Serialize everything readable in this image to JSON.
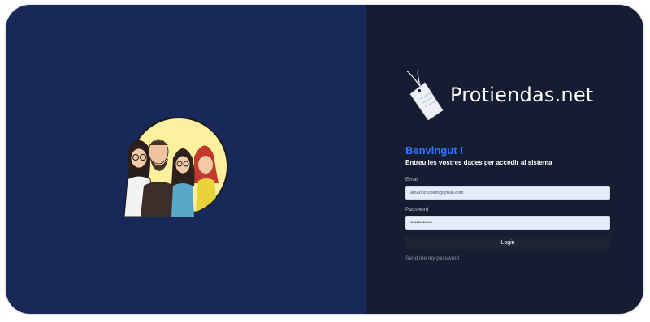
{
  "brand": {
    "name": "Protiendas.net",
    "logo_icon": "price-tag-icon"
  },
  "illustration": {
    "icon": "team-avatar-illustration"
  },
  "login": {
    "welcome": "Benvingut !",
    "subtitle": "Entreu les vostres dades per accedir al sistema",
    "email_label": "Email",
    "email_value": "amadricurdelb@gmail.com",
    "password_label": "Password",
    "password_value": "••••••••••••••",
    "login_button": "Login",
    "forgot_link": "Send me my password"
  },
  "colors": {
    "left_panel_bg": "#182858",
    "right_panel_bg": "#161c31",
    "accent": "#2f74ff",
    "input_bg": "#e7ecfb",
    "button_bg": "#1e2232"
  }
}
